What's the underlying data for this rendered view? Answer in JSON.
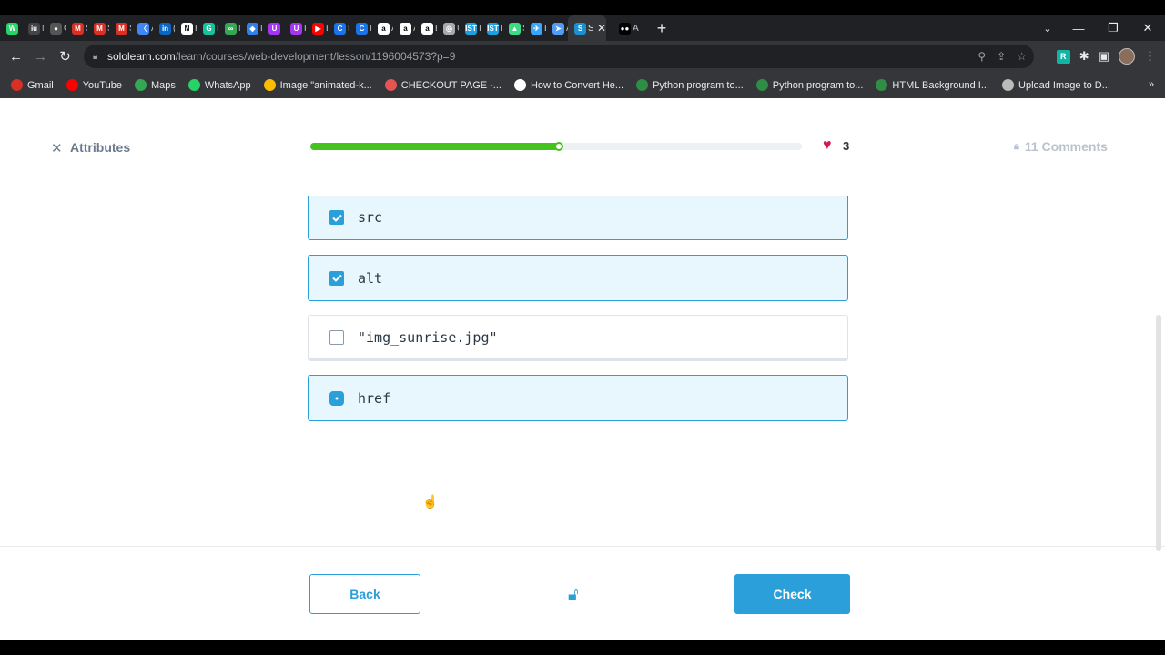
{
  "browser": {
    "tabs": [
      {
        "icon": "whatsapp-icon",
        "color": "#25d366",
        "glyph": "W",
        "label": ""
      },
      {
        "icon": "iu-icon",
        "color": "#444444",
        "glyph": "iu",
        "label": "M"
      },
      {
        "icon": "github-icon",
        "color": "#555555",
        "glyph": "●",
        "label": "G"
      },
      {
        "icon": "gmail-icon",
        "color": "#d93025",
        "glyph": "M",
        "label": "S"
      },
      {
        "icon": "gmail-icon",
        "color": "#d93025",
        "glyph": "M",
        "label": "S"
      },
      {
        "icon": "gmail-icon",
        "color": "#d93025",
        "glyph": "M",
        "label": "S"
      },
      {
        "icon": "code-icon",
        "color": "#4285f4",
        "glyph": "〈",
        "label": "A"
      },
      {
        "icon": "linkedin-icon",
        "color": "#0a66c2",
        "glyph": "in",
        "label": "("
      },
      {
        "icon": "notion-icon",
        "color": "#ffffff",
        "glyph": "N",
        "label": "R"
      },
      {
        "icon": "grammarly-icon",
        "color": "#15c39a",
        "glyph": "G",
        "label": "M"
      },
      {
        "icon": "link-icon",
        "color": "#34a853",
        "glyph": "∞",
        "label": "N"
      },
      {
        "icon": "vscode-icon",
        "color": "#2f80ed",
        "glyph": "◆",
        "label": "D"
      },
      {
        "icon": "u-icon",
        "color": "#a435f0",
        "glyph": "U",
        "label": "T"
      },
      {
        "icon": "u-icon",
        "color": "#a435f0",
        "glyph": "U",
        "label": "F"
      },
      {
        "icon": "youtube-icon",
        "color": "#ff0000",
        "glyph": "▶",
        "label": "E"
      },
      {
        "icon": "c-icon",
        "color": "#1a73e8",
        "glyph": "C",
        "label": "F"
      },
      {
        "icon": "c-icon",
        "color": "#1a73e8",
        "glyph": "C",
        "label": "Ir"
      },
      {
        "icon": "amazon-icon",
        "color": "#ffffff",
        "glyph": "a",
        "label": "A"
      },
      {
        "icon": "amazon-icon",
        "color": "#ffffff",
        "glyph": "a",
        "label": "A"
      },
      {
        "icon": "amazon-icon",
        "color": "#ffffff",
        "glyph": "a",
        "label": "B"
      },
      {
        "icon": "globe-icon",
        "color": "#aaaaaa",
        "glyph": "◎",
        "label": "U"
      },
      {
        "icon": "ist-icon",
        "color": "#1ba1e2",
        "glyph": "IST",
        "label": "Ir"
      },
      {
        "icon": "ist-icon",
        "color": "#1ba1e2",
        "glyph": "IST",
        "label": "Ir"
      },
      {
        "icon": "android-icon",
        "color": "#3ddc84",
        "glyph": "▲",
        "label": "S"
      },
      {
        "icon": "bird-icon",
        "color": "#35a7ff",
        "glyph": "✈",
        "label": "B"
      },
      {
        "icon": "arrow-icon",
        "color": "#4f9cf7",
        "glyph": "➤",
        "label": "A"
      }
    ],
    "active_tab_label": "Sc",
    "last_tab_label": "A",
    "url_host": "sololearn.com",
    "url_path": "/learn/courses/web-development/lesson/1196004573?p=9",
    "bookmarks": [
      {
        "label": "Gmail",
        "color": "#d93025"
      },
      {
        "label": "YouTube",
        "color": "#ff0000"
      },
      {
        "label": "Maps",
        "color": "#34a853"
      },
      {
        "label": "WhatsApp",
        "color": "#25d366"
      },
      {
        "label": "Image \"animated-k...",
        "color": "#fbbc04"
      },
      {
        "label": "CHECKOUT PAGE -...",
        "color": "#e55353"
      },
      {
        "label": "How to Convert He...",
        "color": "#ffffff"
      },
      {
        "label": "Python program to...",
        "color": "#2f8d46"
      },
      {
        "label": "Python program to...",
        "color": "#2f8d46"
      },
      {
        "label": "HTML Background I...",
        "color": "#2f8d46"
      },
      {
        "label": "Upload Image to D...",
        "color": "#bbbbbb"
      }
    ],
    "bookmarks_more": "»"
  },
  "lesson": {
    "title": "Attributes",
    "progress_fraction": 0.505,
    "hearts": "3",
    "comments": "11 Comments",
    "options": [
      {
        "text": "src",
        "checked": true
      },
      {
        "text": "alt",
        "checked": true
      },
      {
        "text": "\"img_sunrise.jpg\"",
        "checked": false
      },
      {
        "text": "href",
        "checked": true
      }
    ],
    "back_label": "Back",
    "check_label": "Check"
  },
  "colors": {
    "accent": "#2b9fd9",
    "progress": "#46c21f",
    "heart": "#d6184c"
  }
}
